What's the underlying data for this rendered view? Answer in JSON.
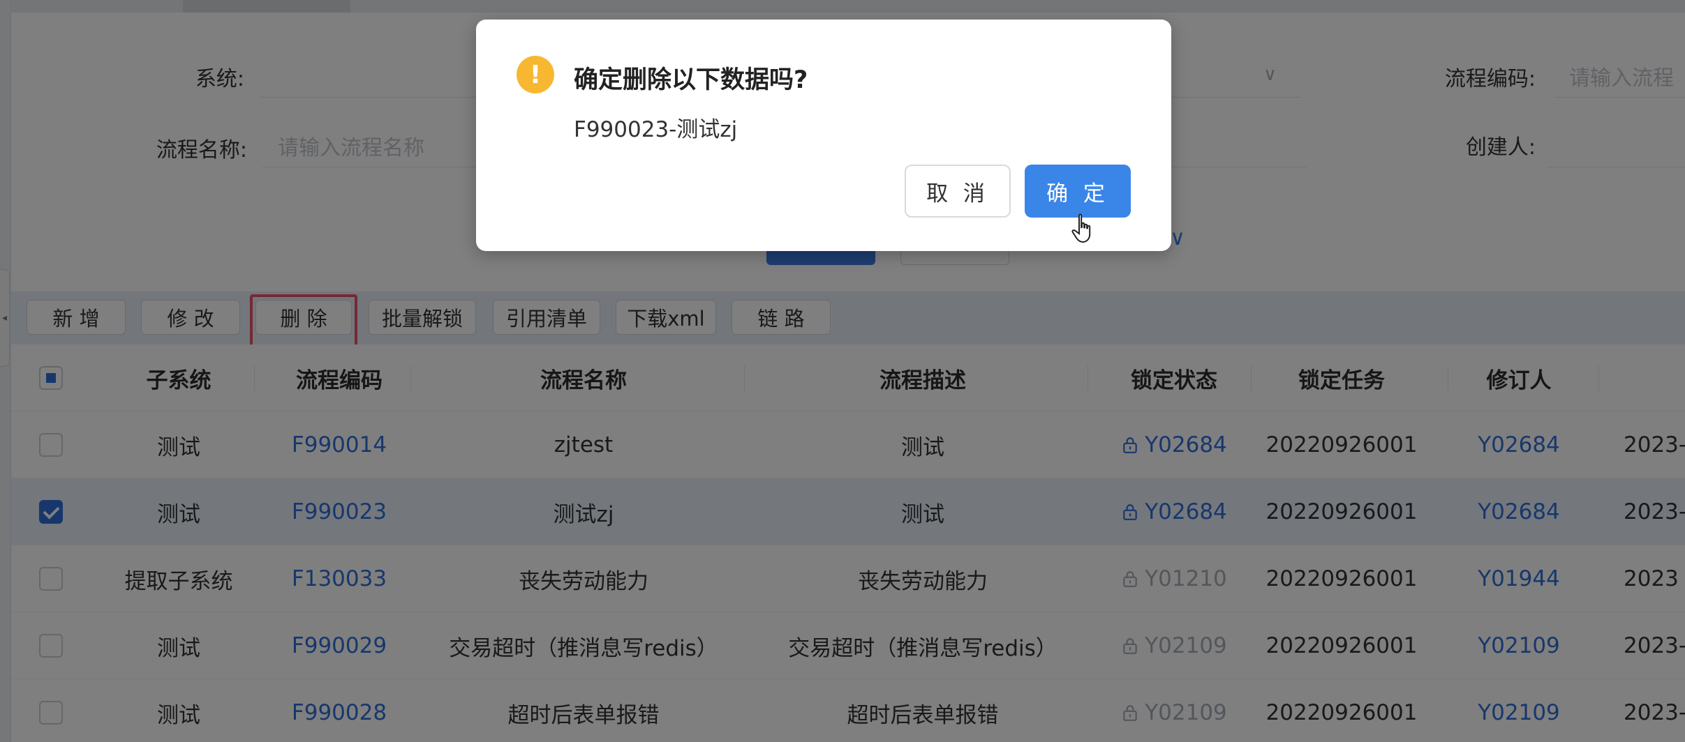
{
  "filters": {
    "system_label": "系统:",
    "process_code_label": "流程编码:",
    "process_code_placeholder": "请输入流程",
    "process_name_label": "流程名称:",
    "process_name_placeholder": "请输入流程名称",
    "creator_label": "创建人:"
  },
  "toolbar": {
    "add": "新 增",
    "edit": "修 改",
    "delete": "删 除",
    "batch_unlock": "批量解锁",
    "reference_list": "引用清单",
    "download_xml": "下载xml",
    "link": "链 路"
  },
  "table": {
    "columns": [
      "子系统",
      "流程编码",
      "流程名称",
      "流程描述",
      "锁定状态",
      "锁定任务",
      "修订人"
    ],
    "rows": [
      {
        "subsystem": "测试",
        "code": "F990014",
        "name": "zjtest",
        "desc": "测试",
        "lock": "Y02684",
        "lock_active": true,
        "task": "20220926001",
        "reviser": "Y02684",
        "date": "2023-",
        "checked": false
      },
      {
        "subsystem": "测试",
        "code": "F990023",
        "name": "测试zj",
        "desc": "测试",
        "lock": "Y02684",
        "lock_active": true,
        "task": "20220926001",
        "reviser": "Y02684",
        "date": "2023-",
        "checked": true
      },
      {
        "subsystem": "提取子系统",
        "code": "F130033",
        "name": "丧失劳动能力",
        "desc": "丧失劳动能力",
        "lock": "Y01210",
        "lock_active": false,
        "task": "20220926001",
        "reviser": "Y01944",
        "date": "2023",
        "checked": false
      },
      {
        "subsystem": "测试",
        "code": "F990029",
        "name": "交易超时（推消息写redis）",
        "desc": "交易超时（推消息写redis）",
        "lock": "Y02109",
        "lock_active": false,
        "task": "20220926001",
        "reviser": "Y02109",
        "date": "2023-",
        "checked": false
      },
      {
        "subsystem": "测试",
        "code": "F990028",
        "name": "超时后表单报错",
        "desc": "超时后表单报错",
        "lock": "Y02109",
        "lock_active": false,
        "task": "20220926001",
        "reviser": "Y02109",
        "date": "2023-",
        "checked": false
      }
    ]
  },
  "dialog": {
    "icon": "warning-icon",
    "title": "确定删除以下数据吗?",
    "content": "F990023-测试zj",
    "cancel": "取 消",
    "confirm": "确 定"
  },
  "colors": {
    "primary": "#3a86e8",
    "link": "#2f6fd8",
    "warning": "#f7b731",
    "highlight": "#e9546b"
  }
}
